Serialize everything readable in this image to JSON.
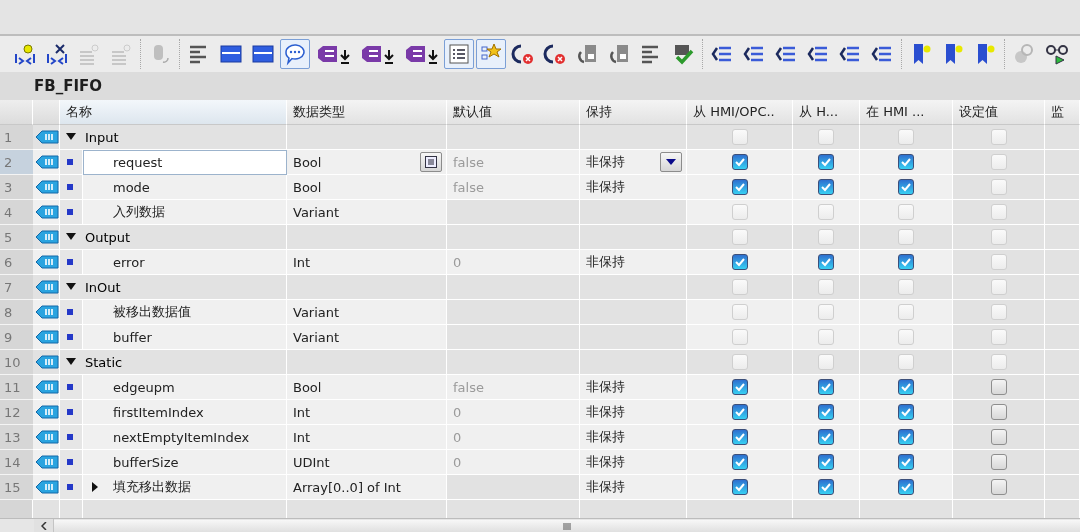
{
  "toolbar": {
    "groups": [
      {
        "buttons": [
          {
            "kind": "insert",
            "pressed": false,
            "disabled": false
          },
          {
            "kind": "remove",
            "pressed": false,
            "disabled": false
          },
          {
            "kind": "spark",
            "pressed": false,
            "disabled": true
          },
          {
            "kind": "spark",
            "pressed": false,
            "disabled": true
          }
        ]
      },
      {
        "buttons": [
          {
            "kind": "cylinder",
            "pressed": false,
            "disabled": true
          }
        ]
      },
      {
        "buttons": [
          {
            "kind": "lines",
            "pressed": false,
            "disabled": false
          },
          {
            "kind": "panel",
            "pressed": false,
            "disabled": false
          },
          {
            "kind": "panel",
            "pressed": false,
            "disabled": false
          },
          {
            "kind": "bubble",
            "pressed": true,
            "disabled": false
          },
          {
            "kind": "tag",
            "pressed": false,
            "disabled": false
          },
          {
            "kind": "tag",
            "pressed": false,
            "disabled": false
          },
          {
            "kind": "tag",
            "pressed": false,
            "disabled": false
          },
          {
            "kind": "list",
            "pressed": true,
            "disabled": false
          },
          {
            "kind": "favorite",
            "pressed": true,
            "disabled": false
          },
          {
            "kind": "cancel",
            "pressed": false,
            "disabled": false
          },
          {
            "kind": "cancel",
            "pressed": false,
            "disabled": false
          },
          {
            "kind": "copy",
            "pressed": false,
            "disabled": false
          },
          {
            "kind": "copy",
            "pressed": false,
            "disabled": false
          },
          {
            "kind": "lines",
            "pressed": false,
            "disabled": false
          },
          {
            "kind": "check",
            "pressed": false,
            "disabled": false
          }
        ]
      },
      {
        "buttons": [
          {
            "kind": "indent",
            "pressed": false,
            "disabled": false
          },
          {
            "kind": "indent",
            "pressed": false,
            "disabled": false
          },
          {
            "kind": "indent",
            "pressed": false,
            "disabled": false
          },
          {
            "kind": "indent",
            "pressed": false,
            "disabled": false
          },
          {
            "kind": "indent",
            "pressed": false,
            "disabled": false
          },
          {
            "kind": "indent",
            "pressed": false,
            "disabled": false
          }
        ]
      },
      {
        "buttons": [
          {
            "kind": "bookmark",
            "pressed": false,
            "disabled": false
          },
          {
            "kind": "bookmark",
            "pressed": false,
            "disabled": false
          },
          {
            "kind": "bookmark",
            "pressed": false,
            "disabled": false
          }
        ]
      },
      {
        "buttons": [
          {
            "kind": "search",
            "pressed": false,
            "disabled": true
          },
          {
            "kind": "glasses",
            "pressed": false,
            "disabled": false
          }
        ]
      }
    ]
  },
  "block": {
    "title": "FB_FIFO"
  },
  "table": {
    "columns": [
      "名称",
      "数据类型",
      "默认值",
      "保持",
      "从 HMI/OPC..",
      "从 H...",
      "在 HMI ...",
      "设定值",
      "监"
    ],
    "rows": [
      {
        "num": "1",
        "kind": "section",
        "expanded": true,
        "name": "Input",
        "type": "",
        "default": "",
        "retain": "",
        "selected": false,
        "checks": [
          {
            "checked": false,
            "disabled": true
          },
          {
            "checked": false,
            "disabled": true
          },
          {
            "checked": false,
            "disabled": true
          },
          {
            "checked": false,
            "disabled": true
          }
        ]
      },
      {
        "num": "2",
        "kind": "member",
        "name": "request",
        "type": "Bool",
        "default": "false",
        "retain": "非保持",
        "selected": true,
        "checks": [
          {
            "checked": true,
            "disabled": false
          },
          {
            "checked": true,
            "disabled": false
          },
          {
            "checked": true,
            "disabled": false
          },
          {
            "checked": false,
            "disabled": true
          }
        ]
      },
      {
        "num": "3",
        "kind": "member",
        "name": "mode",
        "type": "Bool",
        "default": "false",
        "retain": "非保持",
        "selected": false,
        "checks": [
          {
            "checked": true,
            "disabled": false
          },
          {
            "checked": true,
            "disabled": false
          },
          {
            "checked": true,
            "disabled": false
          },
          {
            "checked": false,
            "disabled": true
          }
        ]
      },
      {
        "num": "4",
        "kind": "member",
        "name": "入列数据",
        "type": "Variant",
        "default": "",
        "retain": "",
        "selected": false,
        "checks": [
          {
            "checked": false,
            "disabled": true
          },
          {
            "checked": false,
            "disabled": true
          },
          {
            "checked": false,
            "disabled": true
          },
          {
            "checked": false,
            "disabled": true
          }
        ]
      },
      {
        "num": "5",
        "kind": "section",
        "expanded": true,
        "name": "Output",
        "type": "",
        "default": "",
        "retain": "",
        "selected": false,
        "checks": [
          {
            "checked": false,
            "disabled": true
          },
          {
            "checked": false,
            "disabled": true
          },
          {
            "checked": false,
            "disabled": true
          },
          {
            "checked": false,
            "disabled": true
          }
        ]
      },
      {
        "num": "6",
        "kind": "member",
        "name": "error",
        "type": "Int",
        "default": "0",
        "retain": "非保持",
        "selected": false,
        "checks": [
          {
            "checked": true,
            "disabled": false
          },
          {
            "checked": true,
            "disabled": false
          },
          {
            "checked": true,
            "disabled": false
          },
          {
            "checked": false,
            "disabled": true
          }
        ]
      },
      {
        "num": "7",
        "kind": "section",
        "expanded": true,
        "name": "InOut",
        "type": "",
        "default": "",
        "retain": "",
        "selected": false,
        "checks": [
          {
            "checked": false,
            "disabled": true
          },
          {
            "checked": false,
            "disabled": true
          },
          {
            "checked": false,
            "disabled": true
          },
          {
            "checked": false,
            "disabled": true
          }
        ]
      },
      {
        "num": "8",
        "kind": "member",
        "name": "被移出数据值",
        "type": "Variant",
        "default": "",
        "retain": "",
        "selected": false,
        "checks": [
          {
            "checked": false,
            "disabled": true
          },
          {
            "checked": false,
            "disabled": true
          },
          {
            "checked": false,
            "disabled": true
          },
          {
            "checked": false,
            "disabled": true
          }
        ]
      },
      {
        "num": "9",
        "kind": "member",
        "name": "buffer",
        "type": "Variant",
        "default": "",
        "retain": "",
        "selected": false,
        "checks": [
          {
            "checked": false,
            "disabled": true
          },
          {
            "checked": false,
            "disabled": true
          },
          {
            "checked": false,
            "disabled": true
          },
          {
            "checked": false,
            "disabled": true
          }
        ]
      },
      {
        "num": "10",
        "kind": "section",
        "expanded": true,
        "name": "Static",
        "type": "",
        "default": "",
        "retain": "",
        "selected": false,
        "checks": [
          {
            "checked": false,
            "disabled": true
          },
          {
            "checked": false,
            "disabled": true
          },
          {
            "checked": false,
            "disabled": true
          },
          {
            "checked": false,
            "disabled": true
          }
        ]
      },
      {
        "num": "11",
        "kind": "member",
        "name": "edgeupm",
        "type": "Bool",
        "default": "false",
        "retain": "非保持",
        "selected": false,
        "checks": [
          {
            "checked": true,
            "disabled": false
          },
          {
            "checked": true,
            "disabled": false
          },
          {
            "checked": true,
            "disabled": false
          },
          {
            "checked": false,
            "disabled": false
          }
        ]
      },
      {
        "num": "12",
        "kind": "member",
        "name": "firstItemIndex",
        "type": "Int",
        "default": "0",
        "retain": "非保持",
        "selected": false,
        "checks": [
          {
            "checked": true,
            "disabled": false
          },
          {
            "checked": true,
            "disabled": false
          },
          {
            "checked": true,
            "disabled": false
          },
          {
            "checked": false,
            "disabled": false
          }
        ]
      },
      {
        "num": "13",
        "kind": "member",
        "name": "nextEmptyItemIndex",
        "type": "Int",
        "default": "0",
        "retain": "非保持",
        "selected": false,
        "checks": [
          {
            "checked": true,
            "disabled": false
          },
          {
            "checked": true,
            "disabled": false
          },
          {
            "checked": true,
            "disabled": false
          },
          {
            "checked": false,
            "disabled": false
          }
        ]
      },
      {
        "num": "14",
        "kind": "member",
        "name": "bufferSize",
        "type": "UDInt",
        "default": "0",
        "retain": "非保持",
        "selected": false,
        "checks": [
          {
            "checked": true,
            "disabled": false
          },
          {
            "checked": true,
            "disabled": false
          },
          {
            "checked": true,
            "disabled": false
          },
          {
            "checked": false,
            "disabled": false
          }
        ]
      },
      {
        "num": "15",
        "kind": "member",
        "expanded": false,
        "name": "填充移出数据",
        "type": "Array[0..0] of Int",
        "default": "",
        "retain": "非保持",
        "selected": false,
        "checks": [
          {
            "checked": true,
            "disabled": false
          },
          {
            "checked": true,
            "disabled": false
          },
          {
            "checked": true,
            "disabled": false
          },
          {
            "checked": false,
            "disabled": false
          }
        ]
      }
    ]
  }
}
